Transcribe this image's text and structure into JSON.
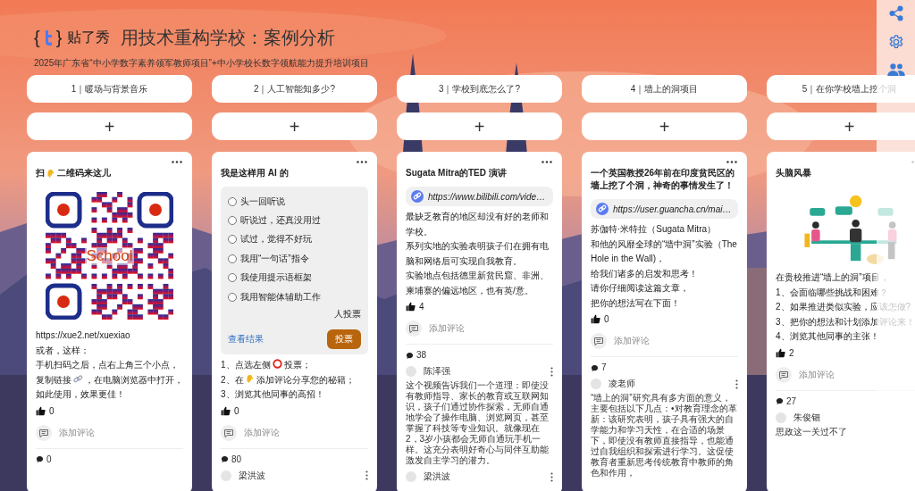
{
  "header": {
    "logo_left": "{",
    "logo_text": "贴了秀",
    "logo_right": "}",
    "title": "用技术重构学校：案例分析",
    "subtitle": "2025年广东省“中小学数字素养领军教师项目”+中小学校长数字领航能力提升培训项目"
  },
  "columns": [
    {
      "title": "1｜暖场与背景音乐",
      "add": "+",
      "post": {
        "title": [
          {
            "kind": "text",
            "text": "扫"
          },
          {
            "kind": "pointer"
          },
          {
            "kind": "text",
            "text": "二维码来这儿"
          }
        ],
        "qr_label": "School",
        "body": [
          [
            {
              "kind": "text",
              "text": "https://xue2.net/xuexiao"
            }
          ],
          [
            {
              "kind": "text",
              "text": "或者，这样："
            }
          ],
          [
            {
              "kind": "text",
              "text": "手机扫码之后，点右上角三个小点，"
            }
          ],
          [
            {
              "kind": "text",
              "text": "复制链接"
            },
            {
              "kind": "link"
            },
            {
              "kind": "text",
              "text": "，在电脑浏览器中打开，"
            }
          ],
          [
            {
              "kind": "text",
              "text": "如此使用，效果更佳！"
            }
          ]
        ],
        "likes": "0",
        "add_comment": "添加评论",
        "comment_count": "0"
      }
    },
    {
      "title": "2｜人工智能知多少?",
      "add": "+",
      "post": {
        "title": [
          {
            "kind": "text",
            "text": "我是这样用 AI 的"
          }
        ],
        "poll": {
          "options": [
            {
              "label": "头一回听说",
              "selected": false
            },
            {
              "label": "听说过，还真没用过",
              "selected": false
            },
            {
              "label": "试过，觉得不好玩",
              "selected": false
            },
            {
              "label": "我用“一句话”指令",
              "selected": false
            },
            {
              "label": "我使用提示语框架",
              "selected": false
            },
            {
              "label": "我用智能体辅助工作",
              "selected": false
            }
          ],
          "voters": "人投票",
          "results": "查看结果",
          "vote": "投票"
        },
        "body": [
          [
            {
              "kind": "text",
              "text": "1、点选左侧"
            },
            {
              "kind": "ring"
            },
            {
              "kind": "text",
              "text": "投票；"
            }
          ],
          [
            {
              "kind": "text",
              "text": "2、在"
            },
            {
              "kind": "pointer"
            },
            {
              "kind": "text",
              "text": "添加评论分享您的秘籍；"
            }
          ],
          [
            {
              "kind": "text",
              "text": "3、浏览其他同事的高招！"
            }
          ]
        ],
        "likes": "0",
        "add_comment": "添加评论",
        "comment_count": "80",
        "comments": [
          {
            "author": "梁洪波"
          }
        ]
      }
    },
    {
      "title": "3｜学校到底怎么了?",
      "add": "+",
      "post": {
        "title": [
          {
            "kind": "text",
            "text": "Sugata Mitra的TED 演讲"
          }
        ],
        "link": "https://www.bilibili.com/vide…",
        "body": [
          [
            {
              "kind": "text",
              "text": "最缺乏教育的地区却没有好的老师和学校。"
            }
          ],
          [
            {
              "kind": "text",
              "text": "系列实地的实验表明孩子们在拥有电脑和网络后可实现自我教育。"
            }
          ],
          [
            {
              "kind": "text",
              "text": "实验地点包括德里新贫民窟、非洲、柬埔寨的偏远地区，也有英/意。"
            }
          ]
        ],
        "likes": "4",
        "add_comment": "添加评论",
        "comment_count": "38",
        "comments": [
          {
            "author": "陈泽强",
            "text": "这个视频告诉我们一个道理：即使没有教师指导、家长的教育或互联网知识，孩子们通过协作探索，无师自通地学会了操作电脑、浏览网页，甚至掌握了科技等专业知识。就像现在2，3岁小孩都会无师自通玩手机一样。这充分表明好奇心与同伴互助能激发自主学习的潜力。"
          },
          {
            "author": "梁洪波"
          }
        ]
      }
    },
    {
      "title": "4｜墙上的洞项目",
      "add": "+",
      "post": {
        "title": [
          {
            "kind": "text",
            "text": "一个英国教授26年前在印度贫民区的墙上挖了个洞，神奇的事情发生了！"
          }
        ],
        "link": "https://user.guancha.cn/mai…",
        "body": [
          [
            {
              "kind": "text",
              "text": "苏伽特·米特拉（Sugata Mitra）"
            }
          ],
          [
            {
              "kind": "text",
              "text": "和他的风靡全球的“墙中洞”实验（The Hole in the Wall)，"
            }
          ],
          [
            {
              "kind": "text",
              "text": "给我们诸多的启发和思考！"
            }
          ],
          [
            {
              "kind": "text",
              "text": "请你仔细阅读这篇文章，"
            }
          ],
          [
            {
              "kind": "text",
              "text": "把你的想法写在下面！"
            }
          ]
        ],
        "likes": "0",
        "add_comment": "添加评论",
        "comment_count": "7",
        "comments": [
          {
            "author": "凌老师",
            "text": "“墙上的洞”研究具有多方面的意义，主要包括以下几点：•对教育理念的革新：该研究表明，孩子具有强大的自学能力和学习天性，在合适的场景下，即使没有教师直接指导，也能通过自我组织和探索进行学习。这促使教育者重新思考传统教育中教师的角色和作用，"
          }
        ]
      }
    },
    {
      "title": "5｜在你学校墙上挖个洞",
      "add": "+",
      "post": {
        "title": [
          {
            "kind": "text",
            "text": "头脑风暴"
          }
        ],
        "picture": {
          "kind": "picture"
        },
        "body": [
          [
            {
              "kind": "text",
              "text": "在贵校推进“墙上的洞”项目，"
            }
          ],
          [
            {
              "kind": "text",
              "text": "1、会面临哪些挑战和困难？"
            }
          ],
          [
            {
              "kind": "text",
              "text": "2、如果推进类似实验，应该怎做?"
            }
          ],
          [
            {
              "kind": "text",
              "text": "3、把你的想法和计划添加评论来！"
            }
          ],
          [
            {
              "kind": "text",
              "text": "4、浏览其他同事的主张！"
            }
          ]
        ],
        "likes": "2",
        "add_comment": "添加评论",
        "comment_count": "27",
        "comments": [
          {
            "author": "朱俊钿",
            "text": "思政这一关过不了"
          }
        ]
      }
    }
  ]
}
